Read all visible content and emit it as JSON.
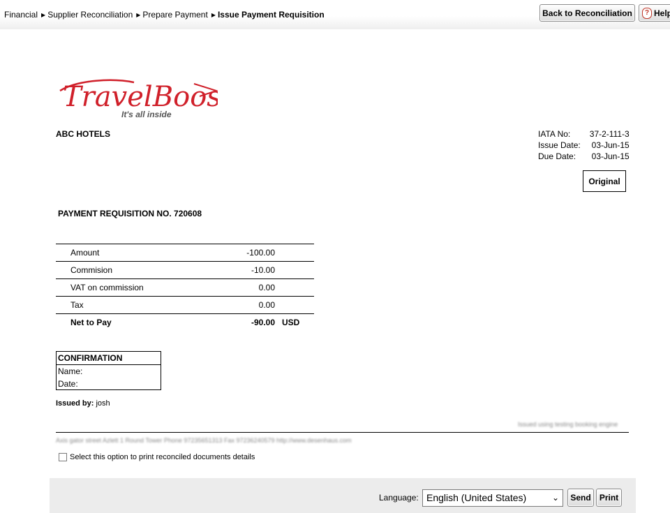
{
  "breadcrumb": {
    "items": [
      "Financial",
      "Supplier Reconciliation",
      "Prepare Payment"
    ],
    "current": "Issue Payment Requisition"
  },
  "toolbar": {
    "back_label": "Back to Reconciliation",
    "help_label": "Help"
  },
  "logo": {
    "brand": "TravelBooster",
    "tagline": "It's all inside",
    "brand_color": "#d0202a"
  },
  "document": {
    "company": "ABC HOTELS",
    "meta": [
      {
        "label": "IATA No:",
        "value": "37-2-111-3"
      },
      {
        "label": "Issue Date:",
        "value": "03-Jun-15"
      },
      {
        "label": "Due Date:",
        "value": "03-Jun-15"
      }
    ],
    "copy_type": "Original",
    "requisition_title": "PAYMENT REQUISITION NO. 720608",
    "lines": [
      {
        "label": "Amount",
        "value": "-100.00"
      },
      {
        "label": "Commision",
        "value": "-10.00"
      },
      {
        "label": "VAT on commission",
        "value": "0.00"
      },
      {
        "label": "Tax",
        "value": "0.00"
      }
    ],
    "total": {
      "label": "Net to Pay",
      "value": "-90.00",
      "currency": "USD"
    },
    "confirmation": {
      "title": "CONFIRMATION",
      "name_label": "Name:",
      "date_label": "Date:"
    },
    "issued_by_label": "Issued by:",
    "issued_by_value": "josh",
    "footer_right": "Issued using testing booking engine",
    "footer_left": "Axis gator street Azlett 1 Round Tower Phone 97235651313 Fax 97236240579 http://www.desenhaus.com"
  },
  "options": {
    "print_details_label": "Select this option to print reconciled documents details"
  },
  "bottom": {
    "language_label": "Language:",
    "language_value": "English (United States)",
    "send_label": "Send",
    "print_label": "Print"
  }
}
